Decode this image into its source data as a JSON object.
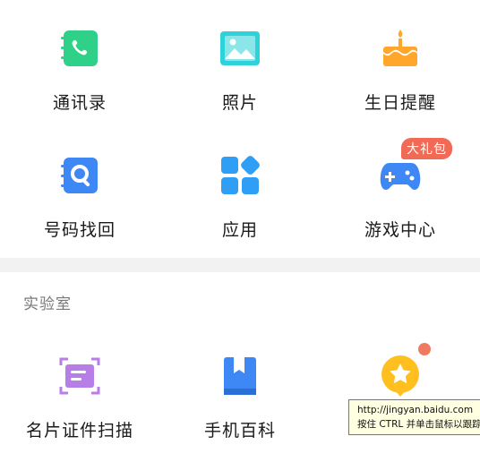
{
  "grid": {
    "items": [
      {
        "label": "通讯录",
        "icon": "contacts-icon"
      },
      {
        "label": "照片",
        "icon": "photo-icon"
      },
      {
        "label": "生日提醒",
        "icon": "birthday-cake-icon"
      },
      {
        "label": "号码找回",
        "icon": "number-recovery-icon"
      },
      {
        "label": "应用",
        "icon": "apps-icon"
      },
      {
        "label": "游戏中心",
        "icon": "gamepad-icon"
      }
    ],
    "game_badge": "大礼包"
  },
  "lab": {
    "title": "实验室",
    "items": [
      {
        "label": "名片证件扫描",
        "icon": "card-scan-icon"
      },
      {
        "label": "手机百科",
        "icon": "bookmark-book-icon"
      },
      {
        "label": "",
        "icon": "star-badge-icon"
      }
    ]
  },
  "tooltip": {
    "url": "http://jingyan.baidu.com",
    "hint": "按住 CTRL 并单击鼠标以跟踪链接"
  },
  "colors": {
    "green": "#2fd188",
    "teal": "#2fd2d8",
    "orange": "#ffa62b",
    "blue": "#3d88f5",
    "purple": "#b77ee8",
    "badge": "#f16a56",
    "section_bg": "#f2f2f2"
  }
}
